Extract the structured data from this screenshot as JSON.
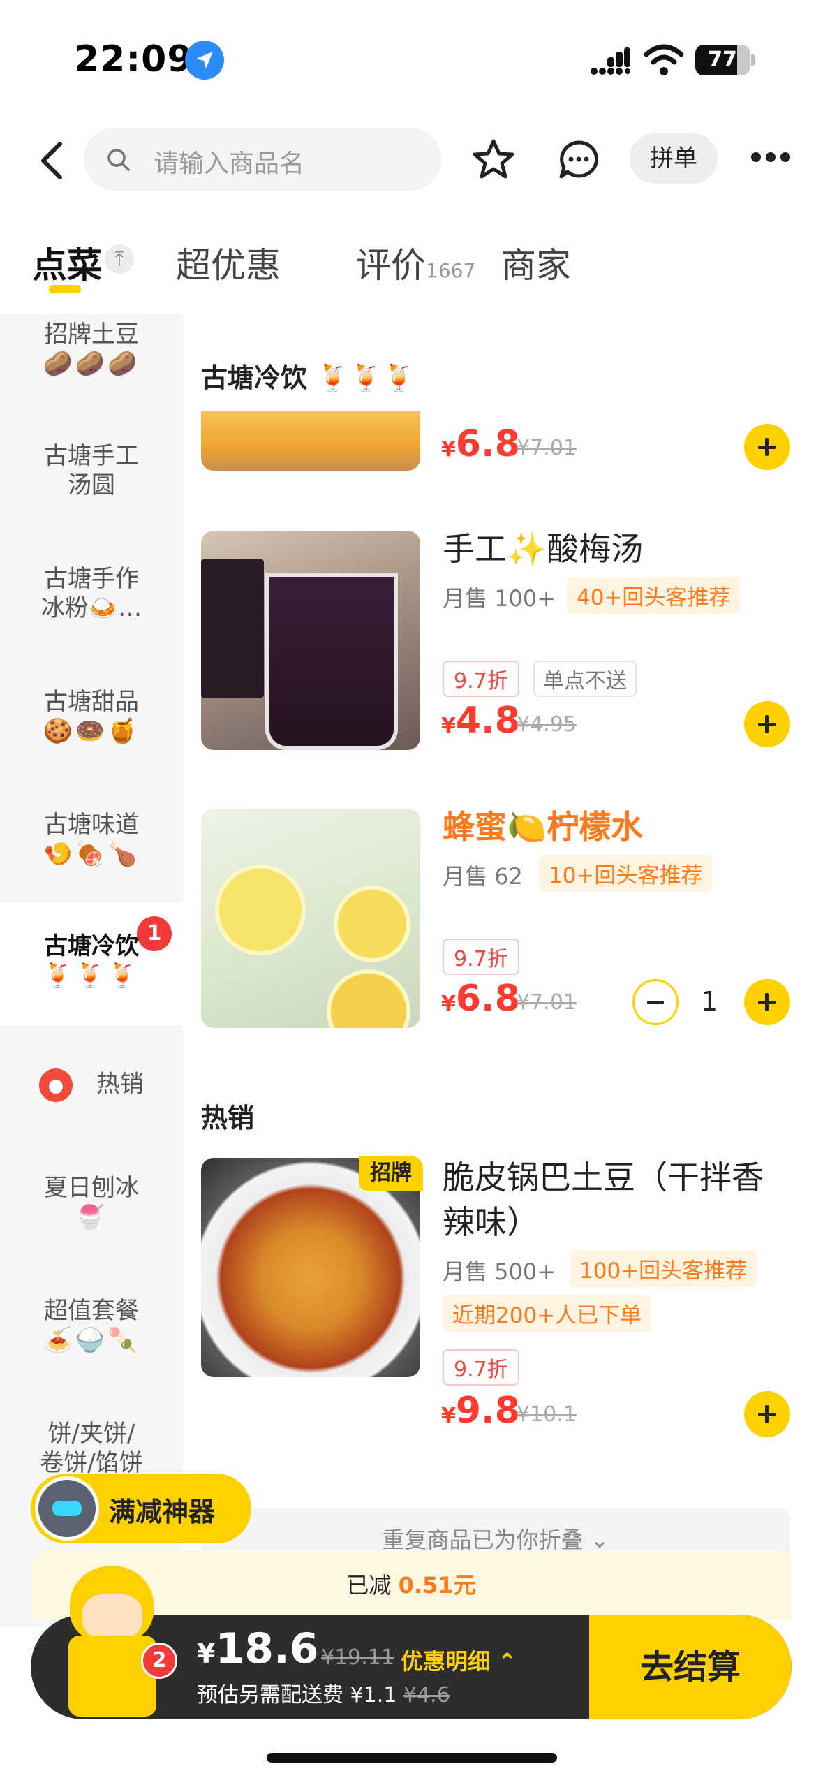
{
  "status_bar": {
    "time": "22:09",
    "battery": "77"
  },
  "header": {
    "search_placeholder": "请输入商品名",
    "pin_label": "拼单"
  },
  "tabs": [
    {
      "label": "点菜"
    },
    {
      "label": "超优惠"
    },
    {
      "label": "评价",
      "count": "1667"
    },
    {
      "label": "商家"
    }
  ],
  "sidebar": {
    "items": [
      {
        "label": "招牌土豆",
        "emoji": "🥔🥔🥔"
      },
      {
        "label": "古塘手工汤圆",
        "line2": "汤圆",
        "line1": "古塘手工"
      },
      {
        "line1": "古塘手作",
        "line2": "冰粉🍛…"
      },
      {
        "label": "古塘甜品",
        "emoji": "🍪🍩🍯"
      },
      {
        "label": "古塘味道",
        "emoji": "🍤🍖🍗"
      },
      {
        "label": "古塘冷饮",
        "emoji": "🍹🍹🍹",
        "badge": "1"
      },
      {
        "label": "热销"
      },
      {
        "label": "夏日刨冰",
        "emoji": "🍧"
      },
      {
        "label": "超值套餐",
        "emoji": "🍝🍚🍡"
      },
      {
        "line1": "饼/夹饼/",
        "line2": "卷饼/馅饼"
      }
    ]
  },
  "menu": {
    "section_cold": "古塘冷饮 🍹🍹🍹",
    "item0": {
      "price_currency": "¥",
      "price": "6.8",
      "orig": "¥7.01"
    },
    "item1": {
      "name": "手工✨酸梅汤",
      "sales": "月售 100+",
      "rec": "40+回头客推荐",
      "discount": "9.7折",
      "nodelivery": "单点不送",
      "price_currency": "¥",
      "price": "4.8",
      "orig": "¥4.95"
    },
    "item2": {
      "name": "蜂蜜🍋柠檬水",
      "sales": "月售 62",
      "rec": "10+回头客推荐",
      "discount": "9.7折",
      "price_currency": "¥",
      "price": "6.8",
      "orig": "¥7.01",
      "qty": "1"
    },
    "section_hot": "热销",
    "item3": {
      "tag": "招牌",
      "name_line1": "脆皮锅巴土豆（干拌香",
      "name_line2": "辣味）",
      "sales": "月售 500+",
      "rec": "100+回头客推荐",
      "rec2": "近期200+人已下单",
      "discount": "9.7折",
      "price_currency": "¥",
      "price": "9.8",
      "orig": "¥10.1"
    },
    "fold_text": "重复商品已为你折叠 ⌄"
  },
  "promo": {
    "label": "满减神器",
    "saved_prefix": "已减 ",
    "saved_value": "0.51元"
  },
  "cart": {
    "badge": "2",
    "currency": "¥",
    "total": "18.6",
    "orig": "¥19.11",
    "detail": "优惠明细 ⌃",
    "fee_prefix": "预估另需配送费 ¥1.1 ",
    "fee_orig": "¥4.6",
    "checkout": "去结算"
  }
}
